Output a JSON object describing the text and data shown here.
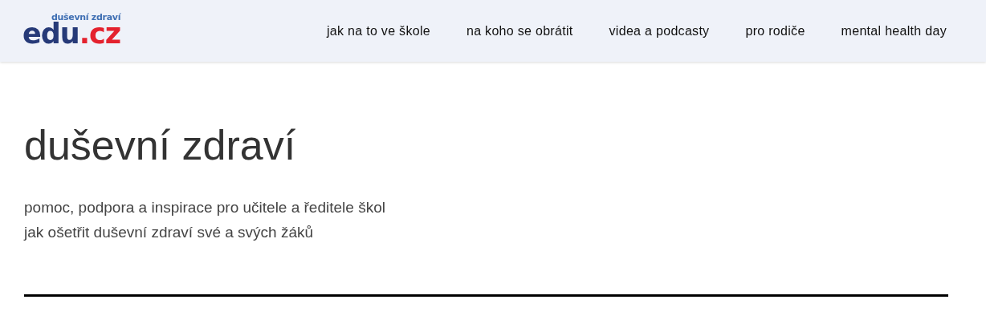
{
  "logo": {
    "tagline": "duševní zdraví",
    "main": "edu",
    "suffix": ".cz"
  },
  "nav": [
    {
      "label": "jak na to ve škole"
    },
    {
      "label": "na koho se obrátit"
    },
    {
      "label": "videa a podcasty"
    },
    {
      "label": "pro rodiče"
    },
    {
      "label": "mental health day"
    }
  ],
  "hero": {
    "title": "duševní zdraví",
    "lines": [
      "pomoc, podpora a inspirace pro učitele a ředitele škol",
      "jak ošetřit duševní zdraví své a svých žáků"
    ]
  }
}
